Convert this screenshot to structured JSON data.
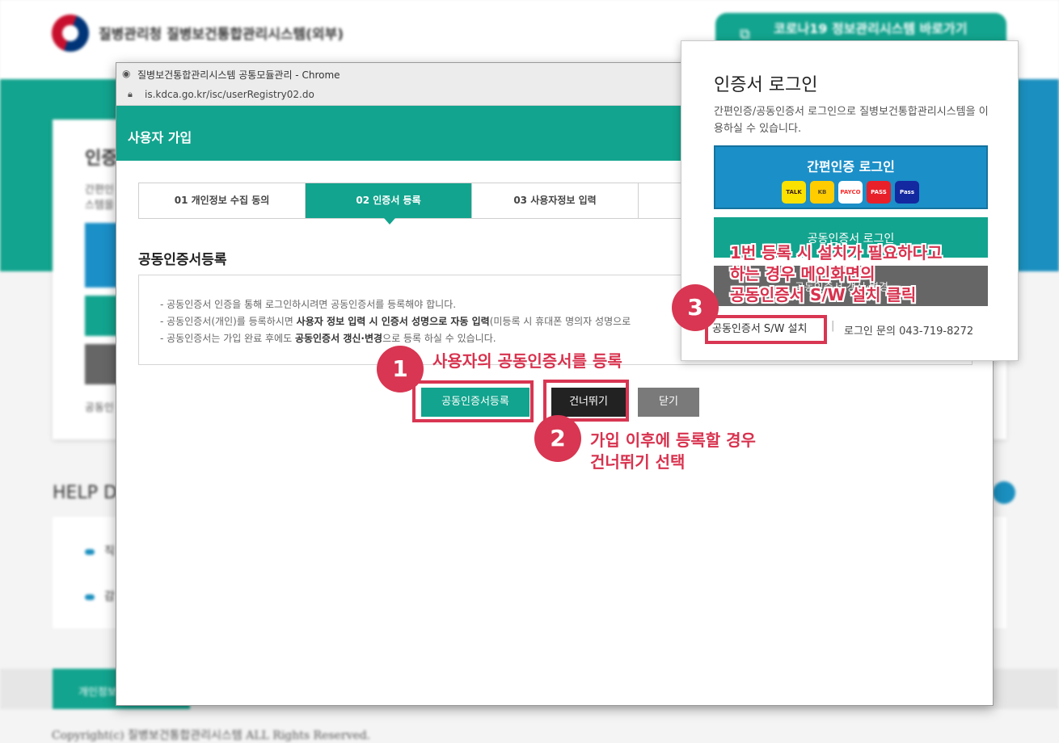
{
  "main_page": {
    "site_title": "질병관리청 질병보건통합관리시스템(외부)",
    "corona_button": "코로나19 정보관리시스템 바로가기",
    "card_heading_fragment": "인증",
    "card_desc_fragment_1": "간편인",
    "card_desc_fragment_2": "스템을",
    "card_footer_fragment": "공동인",
    "help_heading_fragment": "HELP D",
    "help_item_1_fragment": "직",
    "help_item_2_fragment": "감",
    "footer_tab_fragment": "개인정보",
    "copyright": "Copyright(c) 질병보건통합관리시스템 ALL Rights Reserved."
  },
  "popup": {
    "window_title": "질병보건통합관리시스템 공통모듈관리 - Chrome",
    "url": "is.kdca.go.kr/isc/userRegistry02.do",
    "header": "사용자 가입",
    "steps": [
      {
        "label": "01 개인정보 수집 동의"
      },
      {
        "label": "02 인증서 등록"
      },
      {
        "label": "03 사용자정보 입력"
      },
      {
        "label": ""
      }
    ],
    "section_title": "공동인증서등록",
    "info_lines": [
      {
        "pre": "- 공동인증서 인증을 통해 로그인하시려면 공동인증서를 등록해야 합니다.",
        "bold": "",
        "post": ""
      },
      {
        "pre": "- 공동인증서(개인)를 등록하시면 ",
        "bold": "사용자 정보 입력 시 인증서 성명으로 자동 입력",
        "post": "(미등록 시 휴대폰 명의자 성명으로"
      },
      {
        "pre": "- 공동인증서는 가입 완료 후에도 ",
        "bold": "공동인증서 갱신·변경",
        "post": "으로 등록 하실 수 있습니다."
      }
    ],
    "buttons": {
      "register": "공동인증서등록",
      "skip": "건너뛰기",
      "close": "닫기"
    }
  },
  "login_panel": {
    "title": "인증서 로그인",
    "description": "간편인증/공동인증서 로그인으로 질병보건통합관리시스템을 이용하실 수 있습니다.",
    "simple_auth_label": "간편인증 로그인",
    "auth_providers": [
      {
        "name": "TALK",
        "bg": "#fae100",
        "fg": "#3c1e1e"
      },
      {
        "name": "KB",
        "bg": "#ffcc00",
        "fg": "#5a4a2a"
      },
      {
        "name": "PAYCO",
        "bg": "#ffffff",
        "fg": "#ff2a2a"
      },
      {
        "name": "PASS",
        "bg": "#e8202a",
        "fg": "#ffffff"
      },
      {
        "name": "Pass",
        "bg": "#1428a0",
        "fg": "#ffffff"
      }
    ],
    "cert_login_label": "공동인증서 로그인",
    "cert_change_label": "공동인증서 갱신·변경",
    "sw_install_link": "공동인증서 S/W 설치",
    "separator": "|",
    "inquiry": "로그인 문의 043-719-8272"
  },
  "annotations": {
    "step1_number": "1",
    "step1_text": "사용자의 공동인증서를 등록",
    "step2_number": "2",
    "step2_text_line1": "가입 이후에 등록할 경우",
    "step2_text_line2": "건너뛰기 선택",
    "step3_number": "3",
    "step3_text_line1": "1번 등록 시 설치가 필요하다고",
    "step3_text_line2": "하는 경우 메인화면의",
    "step3_text_line3": "공동인증서 S/W 설치 클릭",
    "color": "#d83652"
  },
  "colors": {
    "primary_teal": "#12a48e",
    "simple_auth_blue": "#1b8fc8",
    "dark_button": "#222222"
  }
}
